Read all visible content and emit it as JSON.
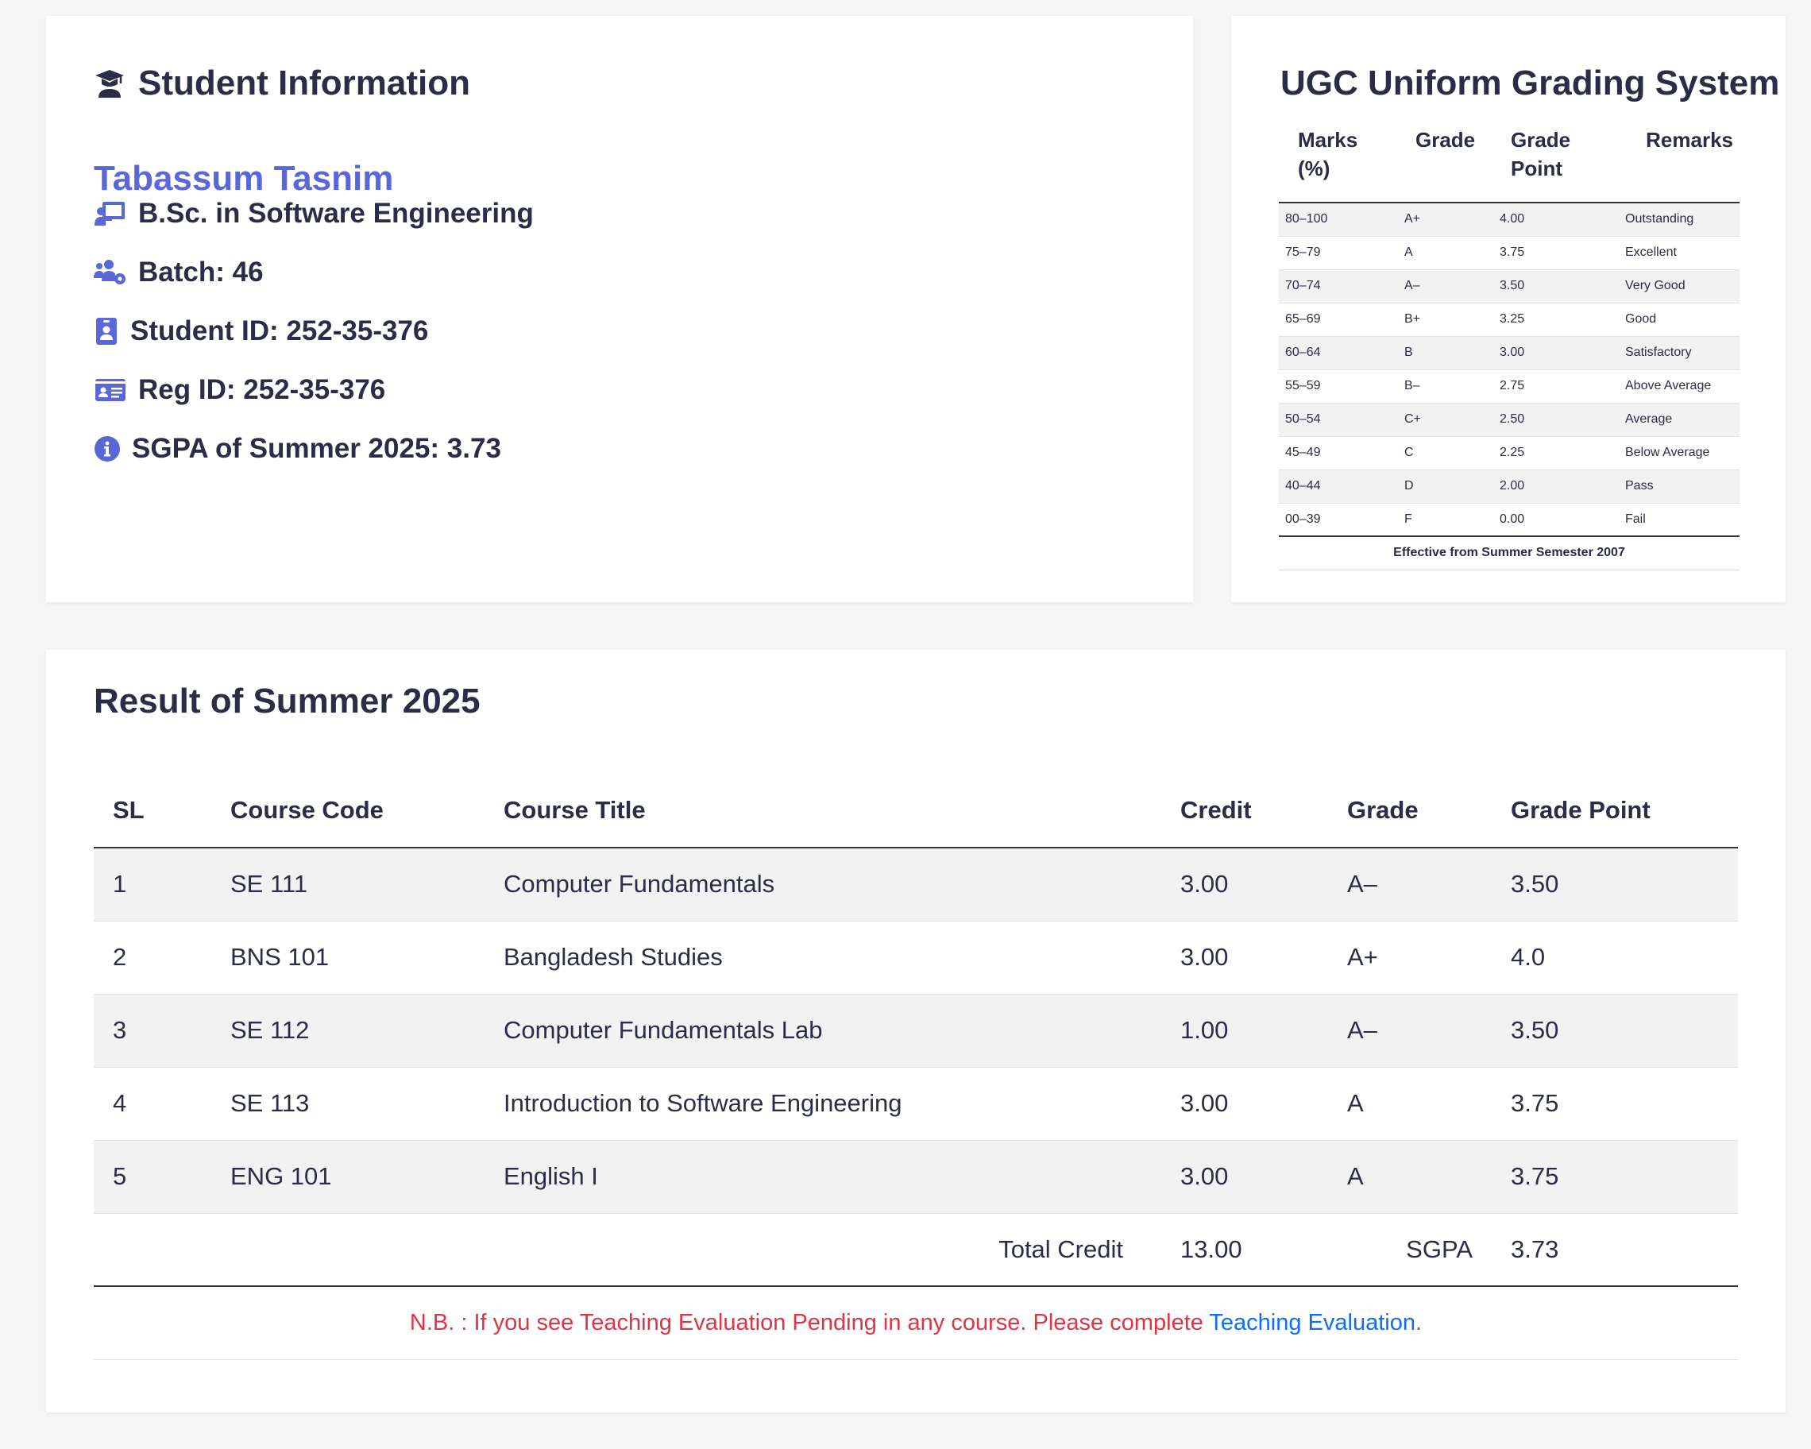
{
  "student_info": {
    "title": "Student Information",
    "name": "Tabassum Tasnim",
    "program": "B.Sc. in Software Engineering",
    "batch": "Batch: 46",
    "student_id": "Student ID: 252-35-376",
    "reg_id": "Reg ID: 252-35-376",
    "sgpa": "SGPA of Summer 2025: 3.73",
    "accent_color": "#5a67d8",
    "icons": [
      "graduation-cap-icon",
      "chalkboard-teacher-icon",
      "users-cog-icon",
      "id-badge-icon",
      "id-card-icon",
      "info-circle-icon"
    ]
  },
  "grading_system": {
    "title": "UGC Uniform Grading System",
    "headers": [
      "Marks (%)",
      "Grade",
      "Grade Point",
      "Remarks"
    ],
    "rows": [
      [
        "80–100",
        "A+",
        "4.00",
        "Outstanding"
      ],
      [
        "75–79",
        "A",
        "3.75",
        "Excellent"
      ],
      [
        "70–74",
        "A–",
        "3.50",
        "Very Good"
      ],
      [
        "65–69",
        "B+",
        "3.25",
        "Good"
      ],
      [
        "60–64",
        "B",
        "3.00",
        "Satisfactory"
      ],
      [
        "55–59",
        "B–",
        "2.75",
        "Above Average"
      ],
      [
        "50–54",
        "C+",
        "2.50",
        "Average"
      ],
      [
        "45–49",
        "C",
        "2.25",
        "Below Average"
      ],
      [
        "40–44",
        "D",
        "2.00",
        "Pass"
      ],
      [
        "00–39",
        "F",
        "0.00",
        "Fail"
      ]
    ],
    "footnote": "Effective from Summer Semester 2007"
  },
  "result": {
    "title": "Result of Summer 2025",
    "headers": [
      "SL",
      "Course Code",
      "Course Title",
      "Credit",
      "Grade",
      "Grade Point"
    ],
    "rows": [
      [
        "1",
        "SE 111",
        "Computer Fundamentals",
        "3.00",
        "A–",
        "3.50"
      ],
      [
        "2",
        "BNS 101",
        "Bangladesh Studies",
        "3.00",
        "A+",
        "4.0"
      ],
      [
        "3",
        "SE 112",
        "Computer Fundamentals Lab",
        "1.00",
        "A–",
        "3.50"
      ],
      [
        "4",
        "SE 113",
        "Introduction to Software Engineering",
        "3.00",
        "A",
        "3.75"
      ],
      [
        "5",
        "ENG 101",
        "English I",
        "3.00",
        "A",
        "3.75"
      ]
    ],
    "total_credit_label": "Total Credit",
    "total_credit": "13.00",
    "sgpa_label": "SGPA",
    "sgpa": "3.73",
    "note_text": "N.B. : If you see Teaching Evaluation Pending in any course. Please complete ",
    "note_link": "Teaching Evaluation",
    "note_end": ".",
    "note_color": "#dc3545",
    "link_color": "#0d6efd"
  }
}
